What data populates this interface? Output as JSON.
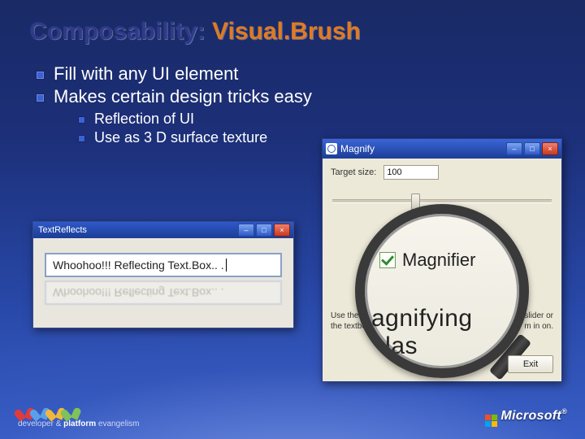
{
  "title_a": "Composability: ",
  "title_b": "Visual.Brush",
  "bullets": {
    "b1": "Fill with any UI element",
    "b2": "Makes certain design tricks easy",
    "s1": "Reflection of UI",
    "s2": "Use as 3 D surface texture"
  },
  "winL": {
    "title": "TextReflects",
    "text": "Whoohoo!!! Reflecting Text.Box.. .",
    "reflect": "Whoohoo!!! Reflecting Text.Box.. ."
  },
  "winR": {
    "title": "Magnify",
    "target_label": "Target size:",
    "target_value": "100",
    "checkbox_label": "Magnifier",
    "zoom_text": "agnifying glas",
    "desc_left": "Use the check",
    "desc_right": "he slider or",
    "desc2_left": "the textbox to",
    "desc2_right": "m in on.",
    "exit": "Exit"
  },
  "footer": {
    "tag_a": "developer & ",
    "tag_b": "platform",
    "tag_c": " evangelism",
    "ms": "Microsoft"
  }
}
